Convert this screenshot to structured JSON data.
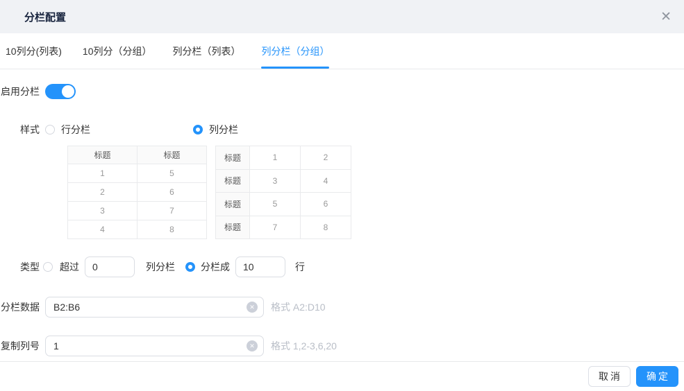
{
  "dialog": {
    "title": "分栏配置",
    "close_icon": "✕"
  },
  "tabs": [
    {
      "label": "10列分(列表)",
      "active": false
    },
    {
      "label": "10列分（分组）",
      "active": false
    },
    {
      "label": "列分栏（列表）",
      "active": false
    },
    {
      "label": "列分栏（分组）",
      "active": true
    }
  ],
  "form": {
    "enable": {
      "label": "启用分栏",
      "on": true
    },
    "style": {
      "label": "样式",
      "option_row": {
        "label": "行分栏",
        "selected": false
      },
      "option_col": {
        "label": "列分栏",
        "selected": true
      }
    },
    "preview_row_table": {
      "headers": [
        "标题",
        "标题"
      ],
      "rows": [
        [
          "1",
          "5"
        ],
        [
          "2",
          "6"
        ],
        [
          "3",
          "7"
        ],
        [
          "4",
          "8"
        ]
      ]
    },
    "preview_col_table": {
      "rows": [
        [
          "标题",
          "1",
          "2"
        ],
        [
          "标题",
          "3",
          "4"
        ],
        [
          "标题",
          "5",
          "6"
        ],
        [
          "标题",
          "7",
          "8"
        ]
      ]
    },
    "type": {
      "label": "类型",
      "option_over": {
        "label": "超过",
        "selected": false,
        "value": "0",
        "suffix": "列分栏"
      },
      "option_into": {
        "label": "分栏成",
        "selected": true,
        "value": "10",
        "suffix": "行"
      }
    },
    "data_range": {
      "label": "分栏数据",
      "value": "B2:B6",
      "hint": "格式 A2:D10"
    },
    "copy_cols": {
      "label": "复制列号",
      "value": "1",
      "hint": "格式 1,2-3,6,20"
    }
  },
  "footer": {
    "cancel": "取消",
    "confirm": "确定"
  },
  "colors": {
    "accent": "#2493fb",
    "header_bg": "#f0f2f5",
    "border": "#e8e9eb",
    "table_header_bg": "#fafafa",
    "hint_text": "#b9bec7"
  }
}
